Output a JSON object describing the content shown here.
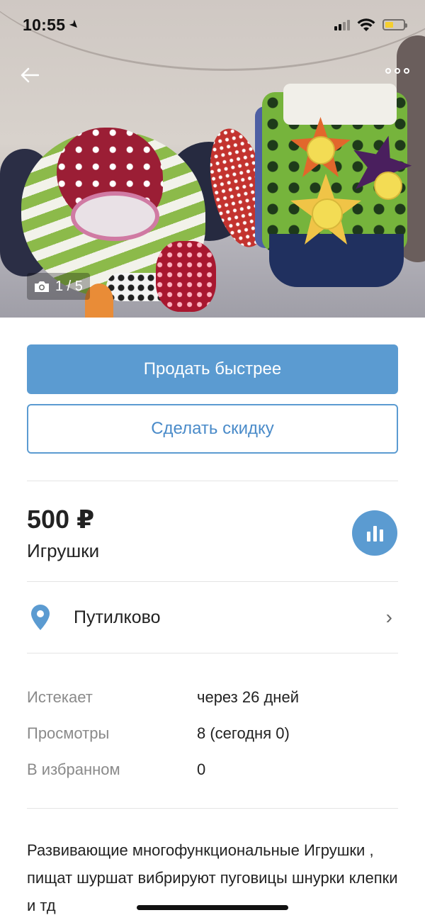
{
  "status_bar": {
    "time": "10:55",
    "battery_level": 0.45
  },
  "photo": {
    "counter": "1 / 5"
  },
  "actions": {
    "sell_faster": "Продать быстрее",
    "make_discount": "Сделать скидку"
  },
  "listing": {
    "price": "500 ₽",
    "category": "Игрушки",
    "location": "Путилково"
  },
  "info": [
    {
      "label": "Истекает",
      "value": "через 26 дней"
    },
    {
      "label": "Просмотры",
      "value": "8 (сегодня 0)"
    },
    {
      "label": "В избранном",
      "value": "0"
    }
  ],
  "description": "Развивающие многофункциональные Игрушки , пищат шуршат вибрируют пуговицы шнурки клепки и тд",
  "colors": {
    "accent": "#5b9bd1",
    "battery": "#f5cf2f"
  }
}
